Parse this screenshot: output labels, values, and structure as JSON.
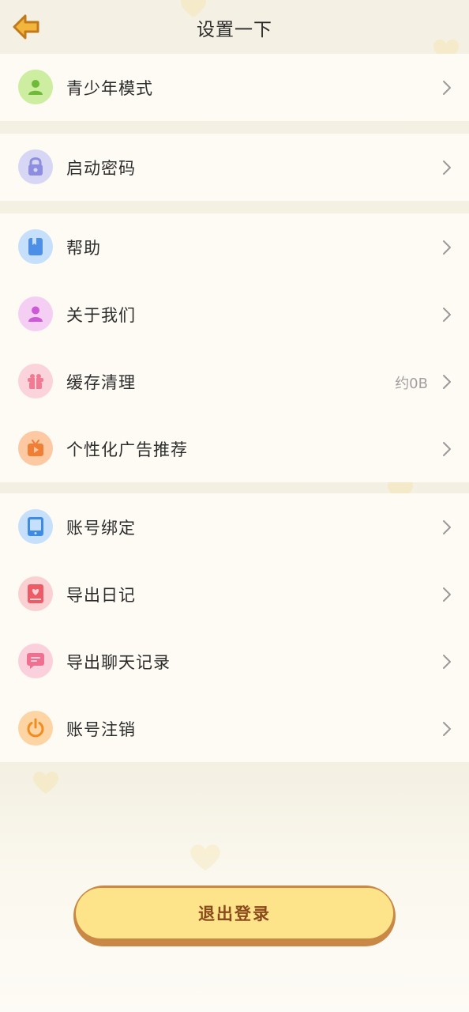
{
  "header": {
    "title": "设置一下",
    "back_icon": "arrow-left-icon"
  },
  "colors": {
    "background": "#f4f0e3",
    "row_background": "#fdfbf3",
    "back_arrow": "#f3b63c",
    "logout_fill": "#fde38a",
    "logout_border": "#c98845",
    "logout_text": "#8a4a1c",
    "chevron": "#9a9a9a"
  },
  "groups": [
    {
      "items": [
        {
          "label": "青少年模式",
          "icon": "teen-person-icon",
          "icon_bg": "#cdeea0",
          "icon_color": "#6fba38"
        }
      ]
    },
    {
      "items": [
        {
          "label": "启动密码",
          "icon": "lock-icon",
          "icon_bg": "#d7d7f5",
          "icon_color": "#8e8ee0"
        }
      ]
    },
    {
      "items": [
        {
          "label": "帮助",
          "icon": "book-icon",
          "icon_bg": "#c6e0fb",
          "icon_color": "#4d8ee6"
        },
        {
          "label": "关于我们",
          "icon": "person-icon",
          "icon_bg": "#f5cff3",
          "icon_color": "#cc5ad6"
        },
        {
          "label": "缓存清理",
          "value": "约0B",
          "icon": "gift-box-icon",
          "icon_bg": "#fbd3da",
          "icon_color": "#f17b95"
        },
        {
          "label": "个性化广告推荐",
          "icon": "tv-play-icon",
          "icon_bg": "#fcc9a3",
          "icon_color": "#f07e34"
        }
      ]
    },
    {
      "items": [
        {
          "label": "账号绑定",
          "icon": "tablet-icon",
          "icon_bg": "#c6e0fb",
          "icon_color": "#3e8be3"
        },
        {
          "label": "导出日记",
          "icon": "diary-heart-icon",
          "icon_bg": "#fbd0d3",
          "icon_color": "#ec5b66"
        },
        {
          "label": "导出聊天记录",
          "icon": "chat-bubble-icon",
          "icon_bg": "#fbd0dd",
          "icon_color": "#f07091"
        },
        {
          "label": "账号注销",
          "icon": "power-icon",
          "icon_bg": "#fdd5a5",
          "icon_color": "#f28c1e"
        }
      ]
    }
  ],
  "logout": {
    "label": "退出登录"
  }
}
